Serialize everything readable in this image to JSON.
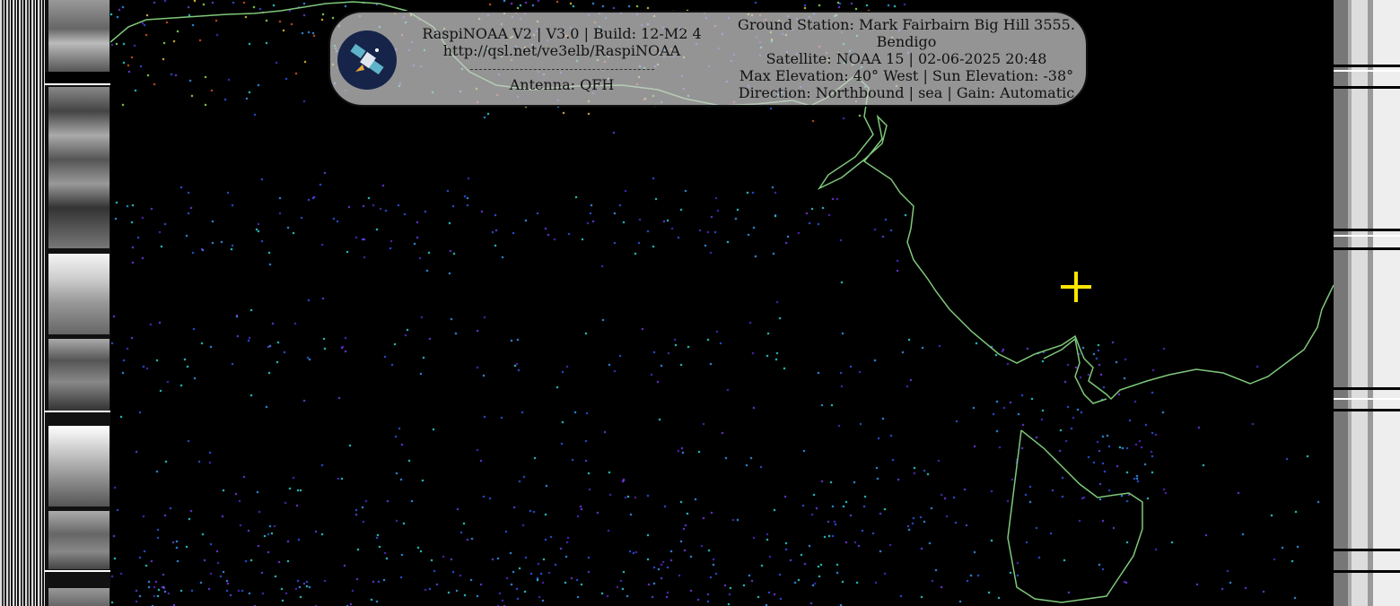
{
  "overlay": {
    "app_line": "RaspiNOAA V2 | V3.0 | Build: 12-M2 4",
    "url": "http://qsl.net/ve3elb/RaspiNOAA",
    "antenna": "Antenna: QFH",
    "ground_station": "Ground Station: Mark Fairbairn Big Hill 3555.",
    "location": "Bendigo",
    "satellite": "Satellite: NOAA 15 | 02-06-2025 20:48",
    "elevation": "Max Elevation: 40° West | Sun Elevation: -38°",
    "direction": "Direction: Northbound | sea | Gain: Automatic"
  },
  "colors": {
    "coastline": "#7ec87a",
    "marker": "#ffe600",
    "background": "#000000",
    "overlay_bg": "#cdcdcd",
    "logo_bg": "#152448",
    "palette": [
      "#5a2bd6",
      "#7a3cf0",
      "#2e5cf5",
      "#3aa0ff",
      "#2ee0e0",
      "#9ef05a",
      "#f0d040",
      "#e05a20"
    ]
  },
  "icons": {
    "logo": "satellite-logo-icon",
    "marker": "crosshair-marker-icon"
  }
}
